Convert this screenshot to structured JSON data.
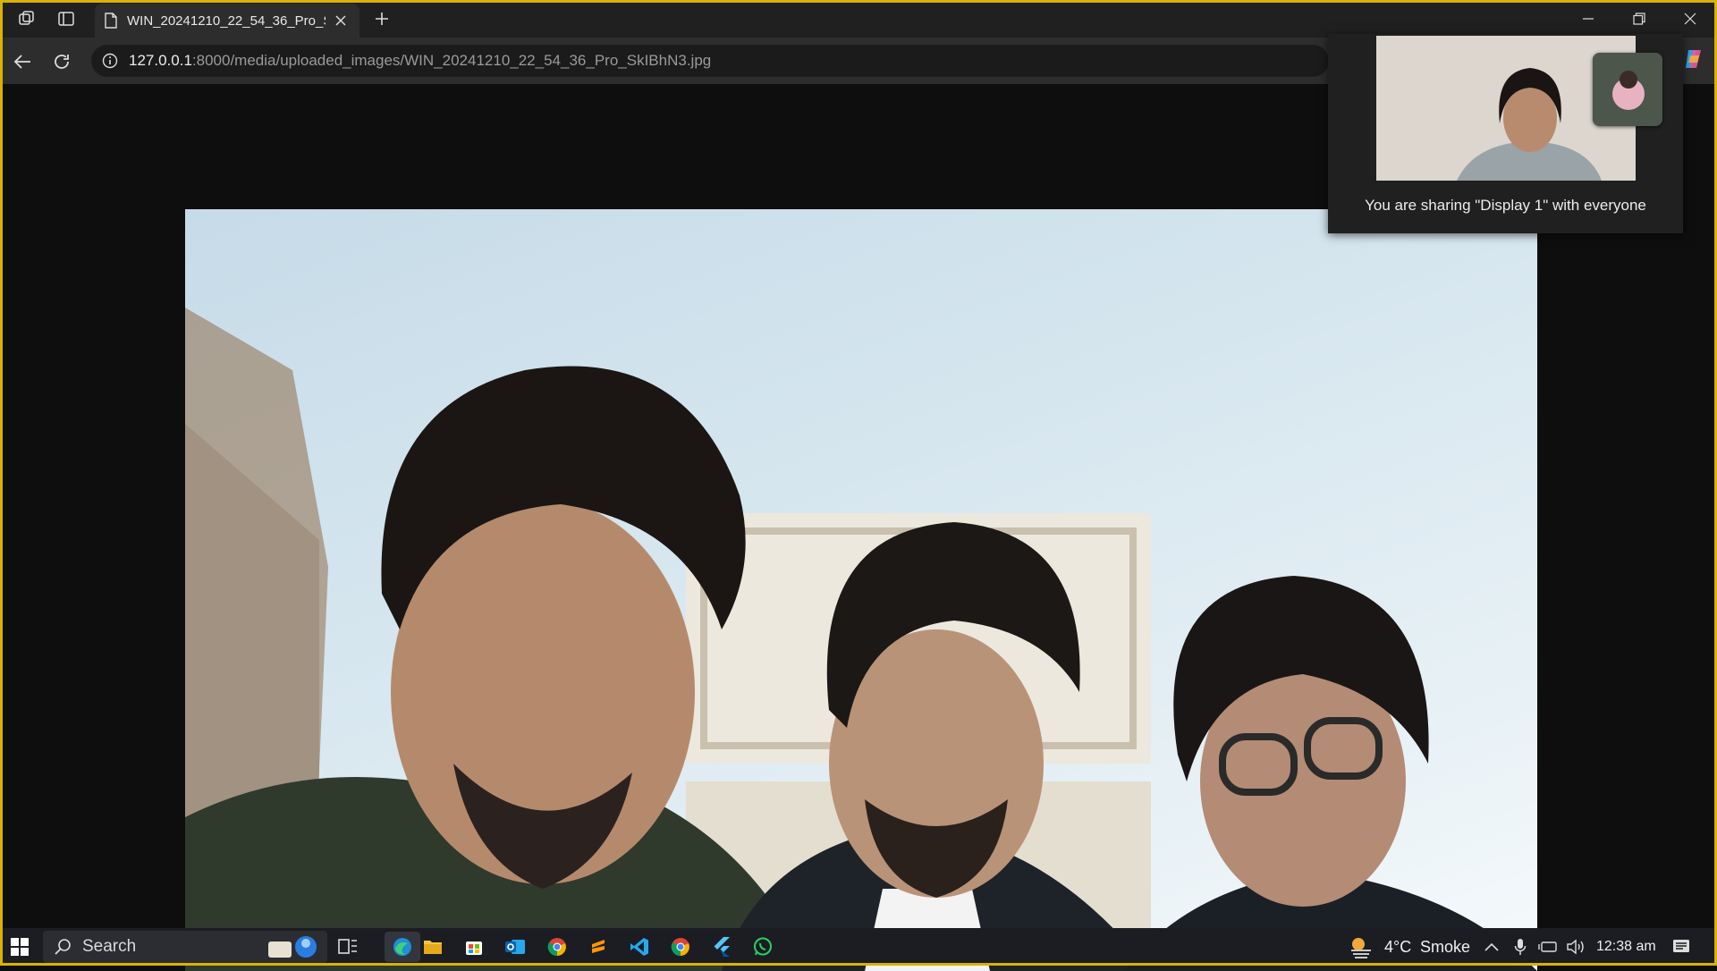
{
  "browser": {
    "tab": {
      "title": "WIN_20241210_22_54_36_Pro_SkIBhN3.jpg"
    },
    "address": {
      "host": "127.0.0.1",
      "rest": ":8000/media/uploaded_images/WIN_20241210_22_54_36_Pro_SkIBhN3.jpg"
    }
  },
  "screen_share": {
    "message": "You are sharing \"Display 1\" with everyone"
  },
  "taskbar": {
    "search_label": "Search",
    "weather": {
      "temperature": "4°C",
      "condition": "Smoke"
    },
    "clock": "12:38 am",
    "pinned_apps": [
      "task-view",
      "edge",
      "file-explorer",
      "store",
      "outlook",
      "chrome",
      "sublime",
      "vscode",
      "chrome",
      "flutter",
      "whatsapp"
    ]
  },
  "colors": {
    "frame_border": "#d9b300",
    "chrome_dark": "#202020",
    "taskbar": "#1b1d22"
  }
}
